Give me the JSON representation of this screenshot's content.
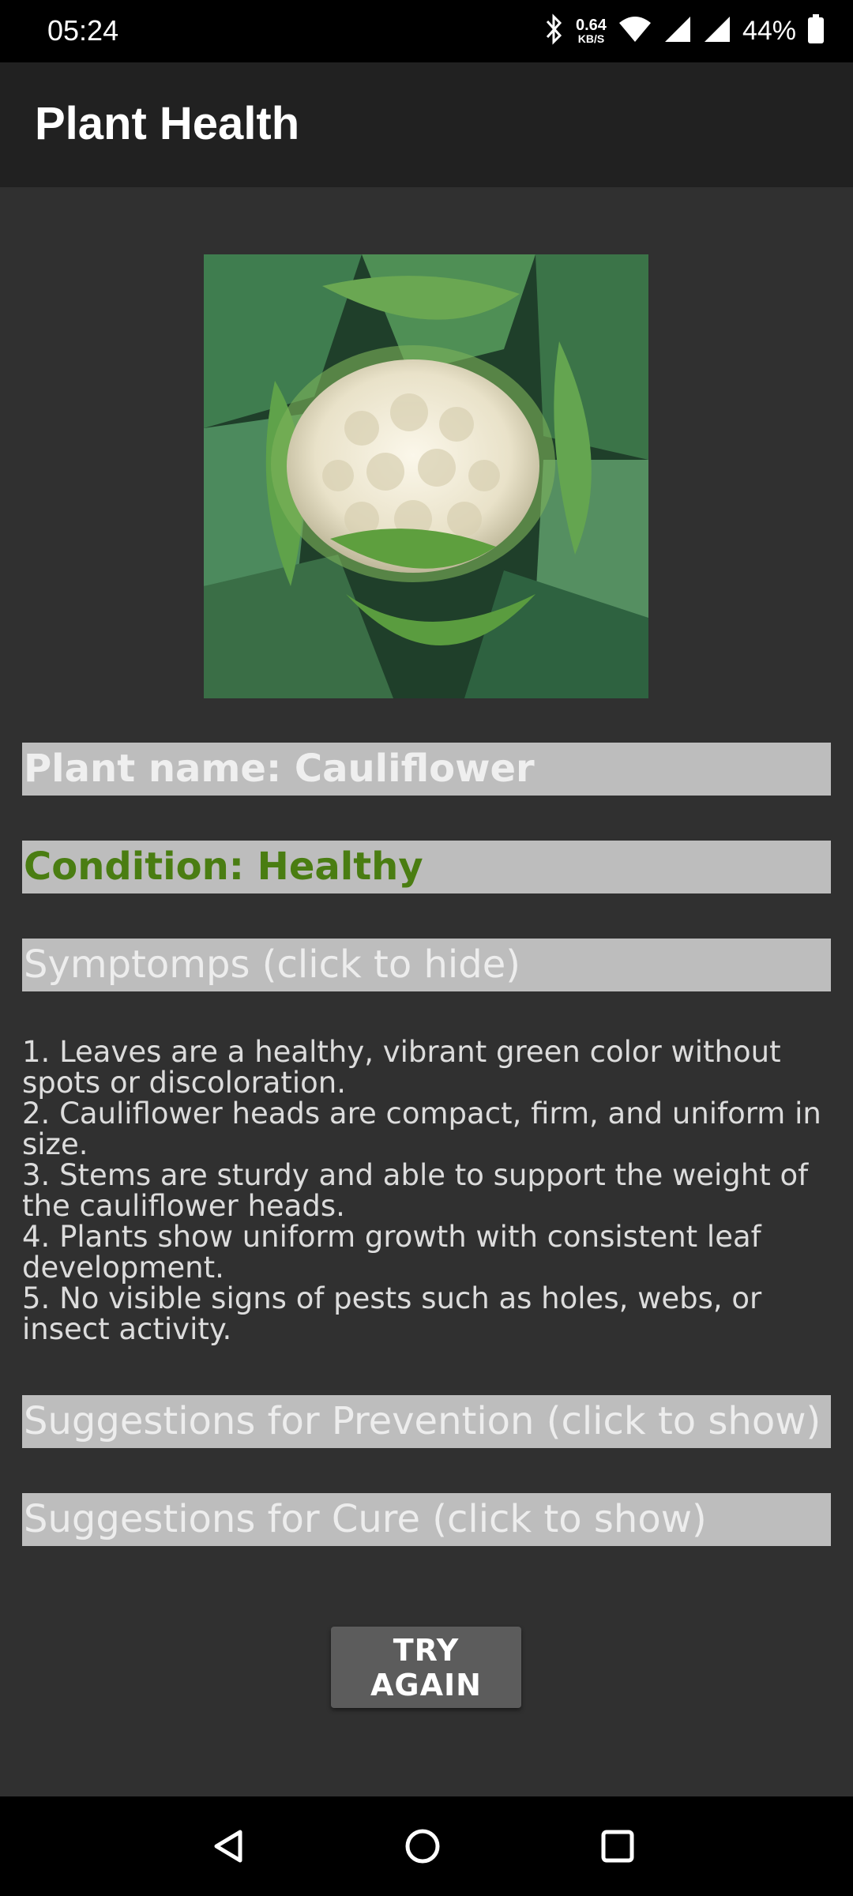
{
  "status_bar": {
    "time": "05:24",
    "net_speed_value": "0.64",
    "net_speed_unit": "KB/S",
    "battery_percent": "44%",
    "icons": [
      "bluetooth-icon",
      "wifi-icon",
      "signal-icon",
      "signal-icon",
      "battery-icon"
    ]
  },
  "app_bar": {
    "title": "Plant Health"
  },
  "plant": {
    "image_icon": "cauliflower-photo",
    "name_label": "Plant name: Cauliflower",
    "condition_label": "Condition: Healthy",
    "condition_color": "#4a7d12"
  },
  "sections": {
    "symptoms_header": "Symptomps (click to hide)",
    "symptoms_lines": [
      "1. Leaves are a healthy, vibrant green color without spots or discoloration.",
      "2. Cauliflower heads are compact, firm, and uniform in size.",
      "3. Stems are sturdy and able to support the weight of the cauliflower heads.",
      "4. Plants show uniform growth with consistent leaf development.",
      "5. No visible signs of pests such as holes, webs, or insect activity."
    ],
    "prevention_header": "Suggestions for Prevention (click to show)",
    "cure_header": "Suggestions for Cure (click to show)"
  },
  "actions": {
    "try_again_label": "TRY AGAIN"
  },
  "nav_bar": {
    "icons": [
      "back-icon",
      "home-icon",
      "recents-icon"
    ]
  },
  "colors": {
    "background": "#303030",
    "app_bar": "#212121",
    "section_bar": "#bdbdbd",
    "button": "#5c5c5c"
  }
}
